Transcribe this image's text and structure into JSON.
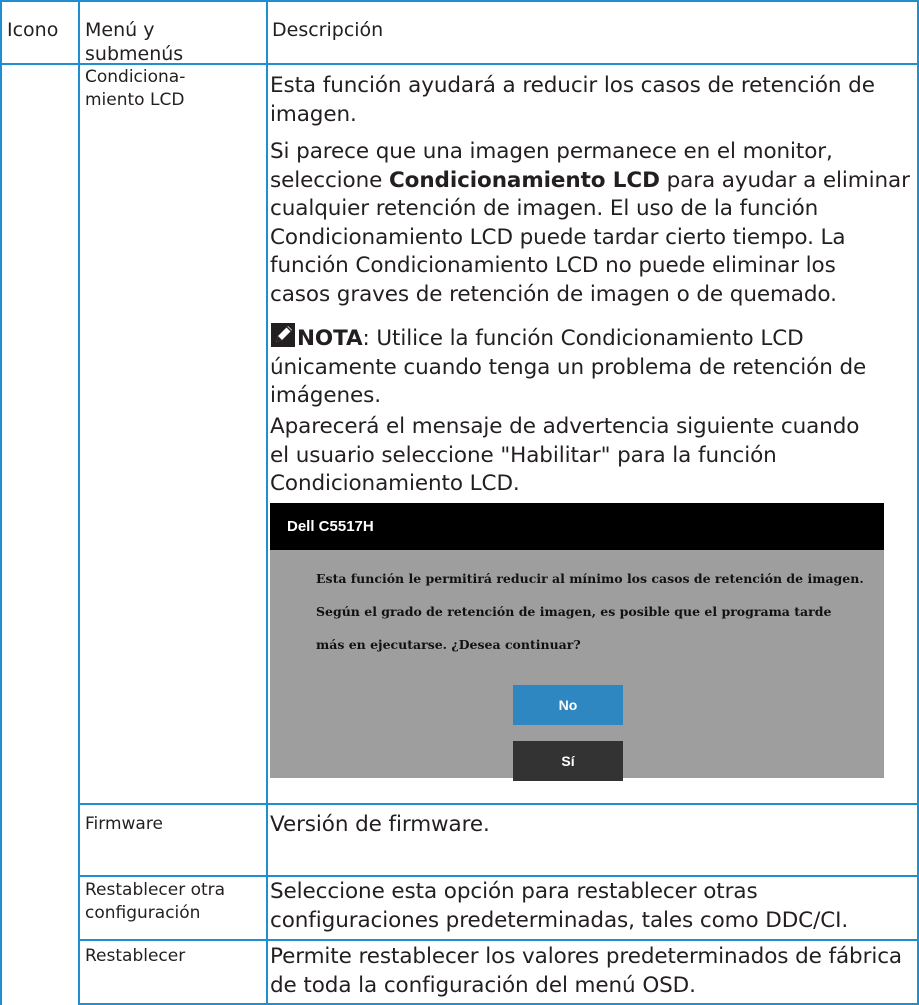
{
  "header": {
    "col_icon": "Icono",
    "col_menu_line1": "Menú y",
    "col_menu_line2": "submenús",
    "col_desc": "Descripción"
  },
  "rows": {
    "lcd": {
      "menu_line1": "Condiciona-",
      "menu_line2": "miento LCD",
      "p1_line1": "Esta función ayudará a reducir los casos de retención de",
      "p1_line2": "imagen.",
      "p2_line1": "Si parece que una imagen permanece en el monitor,",
      "p2_line2_pre": "seleccione ",
      "p2_line2_bold": "Condicionamiento LCD",
      "p2_line2_post": " para ayudar a eliminar",
      "p2_line3": "cualquier retención de imagen. El uso de la función",
      "p2_line4": "Condicionamiento LCD puede tardar cierto tiempo. La",
      "p2_line5": "función Condicionamiento LCD no puede eliminar los",
      "p2_line6": "casos graves de retención de imagen o de quemado.",
      "note_label": "NOTA",
      "note_line1_rest": ": Utilice la función Condicionamiento LCD",
      "note_line2": "únicamente cuando tenga un problema de retención de",
      "note_line3": "imágenes.",
      "p3_line1": "Aparecerá el mensaje de advertencia siguiente cuando",
      "p3_line2": "el usuario seleccione \"Habilitar\" para la función",
      "p3_line3": "Condicionamiento LCD.",
      "note_icon": "pencil-note-icon"
    },
    "firmware": {
      "menu": "Firmware",
      "desc": "Versión de firmware."
    },
    "other_reset": {
      "menu_line1": "Restablecer otra",
      "menu_line2": "configuración",
      "desc_line1": "Seleccione esta opción para restablecer otras",
      "desc_line2": "configuraciones predeterminadas, tales como DDC/CI."
    },
    "reset": {
      "menu": "Restablecer",
      "desc_line1": "Permite restablecer los valores predeterminados de fábrica",
      "desc_line2": "de toda la configuración del menú OSD."
    }
  },
  "dialog": {
    "title": "Dell C5517H",
    "line1": "Esta función le permitirá reducir al mínimo los casos de retención de imagen.",
    "line2": "Según el grado de retención de imagen, es posible que el programa tarde",
    "line3": "más en ejecutarse. ¿Desea continuar?",
    "btn_no": "No",
    "btn_si": "Sí"
  },
  "colors": {
    "grid": "#1e90d0",
    "dialog_bg": "#9e9e9e",
    "dialog_title_bg": "#000000",
    "btn_no": "#2f87c2",
    "btn_si": "#333333"
  }
}
